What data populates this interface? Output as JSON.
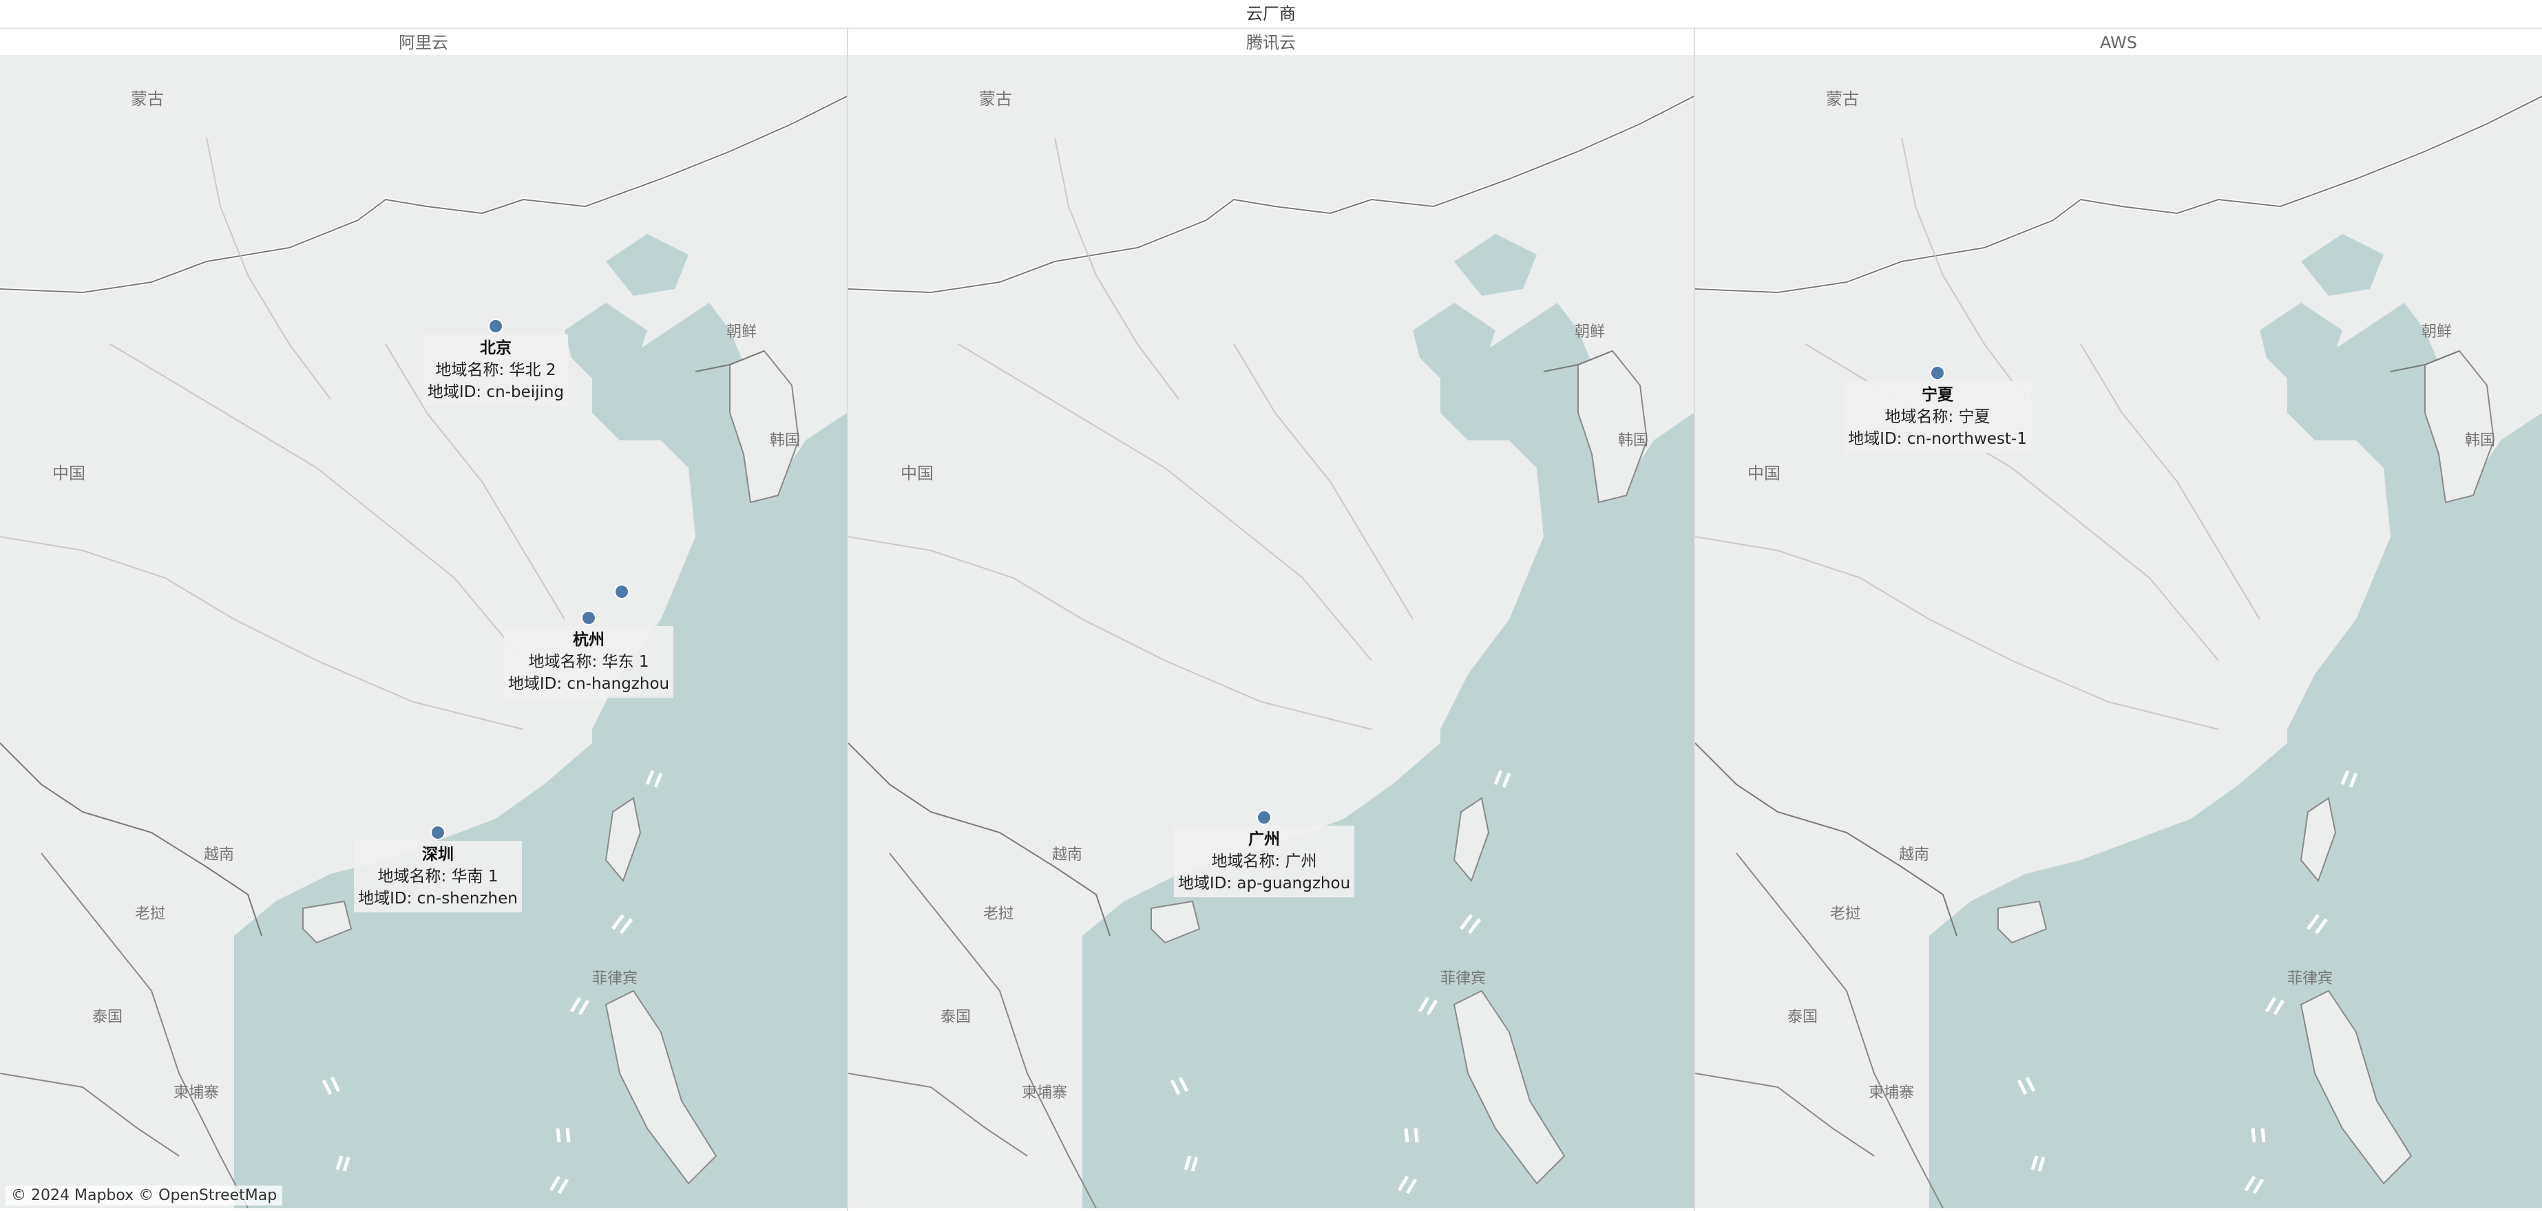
{
  "title": "云厂商",
  "attribution": "© 2024 Mapbox © OpenStreetMap",
  "colors": {
    "marker": "#4e79a7",
    "sea": "#bfd3d3",
    "land": "#eceded",
    "border": "#8a8a8a"
  },
  "map_labels": {
    "mongolia": "蒙古",
    "china": "中国",
    "north_korea": "朝鲜",
    "south_korea": "韩国",
    "vietnam": "越南",
    "laos": "老挝",
    "thailand": "泰国",
    "cambodia": "柬埔寨",
    "philippines": "菲律宾"
  },
  "panels": [
    {
      "name": "阿里云",
      "regions": [
        {
          "city": "北京",
          "name_line": "地域名称: 华北 2",
          "id_line": "地域ID: cn-beijing"
        },
        {
          "city": "杭州",
          "name_line": "地域名称: 华东 1",
          "id_line": "地域ID: cn-hangzhou"
        },
        {
          "city": "深圳",
          "name_line": "地域名称: 华南 1",
          "id_line": "地域ID: cn-shenzhen"
        }
      ]
    },
    {
      "name": "腾讯云",
      "regions": [
        {
          "city": "广州",
          "name_line": "地域名称: 广州",
          "id_line": "地域ID: ap-guangzhou"
        }
      ]
    },
    {
      "name": "AWS",
      "regions": [
        {
          "city": "宁夏",
          "name_line": "地域名称: 宁夏",
          "id_line": "地域ID: cn-northwest-1"
        }
      ]
    }
  ]
}
